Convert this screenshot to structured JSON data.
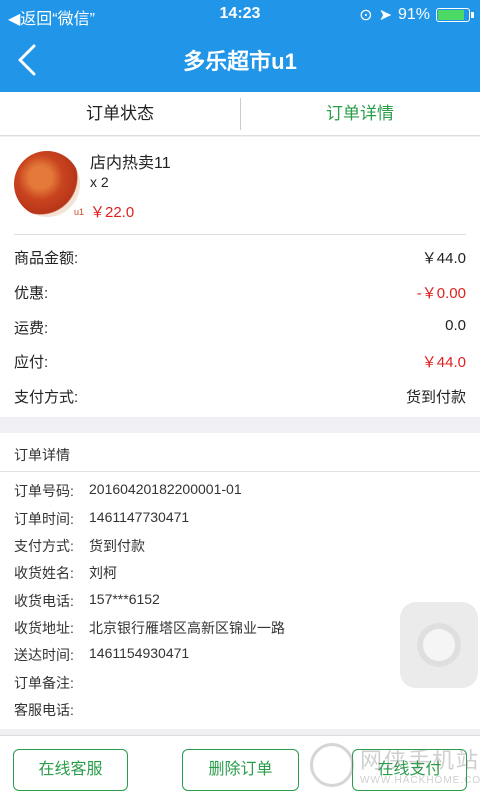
{
  "status_bar": {
    "back_app": "◀返回“微信”",
    "time": "14:23",
    "battery": "91%",
    "battery_level": 0.91
  },
  "nav": {
    "title": "多乐超市u1"
  },
  "tabs": [
    {
      "label": "订单状态",
      "active": false
    },
    {
      "label": "订单详情",
      "active": true
    }
  ],
  "product": {
    "name": "店内热卖11",
    "qty": "x 2",
    "price": "￥22.0",
    "image_tag": "u1"
  },
  "summary": [
    {
      "label": "商品金额:",
      "value": "￥44.0",
      "red": false
    },
    {
      "label": "优惠:",
      "value": "-￥0.00",
      "red": true
    },
    {
      "label": "运费:",
      "value": "0.0",
      "red": false
    },
    {
      "label": "应付:",
      "value": "￥44.0",
      "red": true
    },
    {
      "label": "支付方式:",
      "value": "货到付款",
      "red": false
    }
  ],
  "details": {
    "title": "订单详情",
    "rows": [
      {
        "label": "订单号码:",
        "value": "20160420182200001-01"
      },
      {
        "label": "订单时间:",
        "value": "1461147730471"
      },
      {
        "label": "支付方式:",
        "value": "货到付款"
      },
      {
        "label": "收货姓名:",
        "value": "刘柯"
      },
      {
        "label": "收货电话:",
        "value": "157***6152"
      },
      {
        "label": "收货地址:",
        "value": "北京银行雁塔区高新区锦业一路"
      },
      {
        "label": "送达时间:",
        "value": "1461154930471"
      },
      {
        "label": "订单备注:",
        "value": ""
      },
      {
        "label": "客服电话:",
        "value": ""
      }
    ]
  },
  "buttons": {
    "service": "在线客服",
    "delete": "删除订单",
    "pay": "在线支付"
  },
  "watermark": {
    "brand": "网侠手机站",
    "url": "WWW.HACKHOME.COM"
  },
  "colors": {
    "nav_bg": "#2196e8",
    "accent_green": "#2a9d4a",
    "price_red": "#e02020"
  }
}
